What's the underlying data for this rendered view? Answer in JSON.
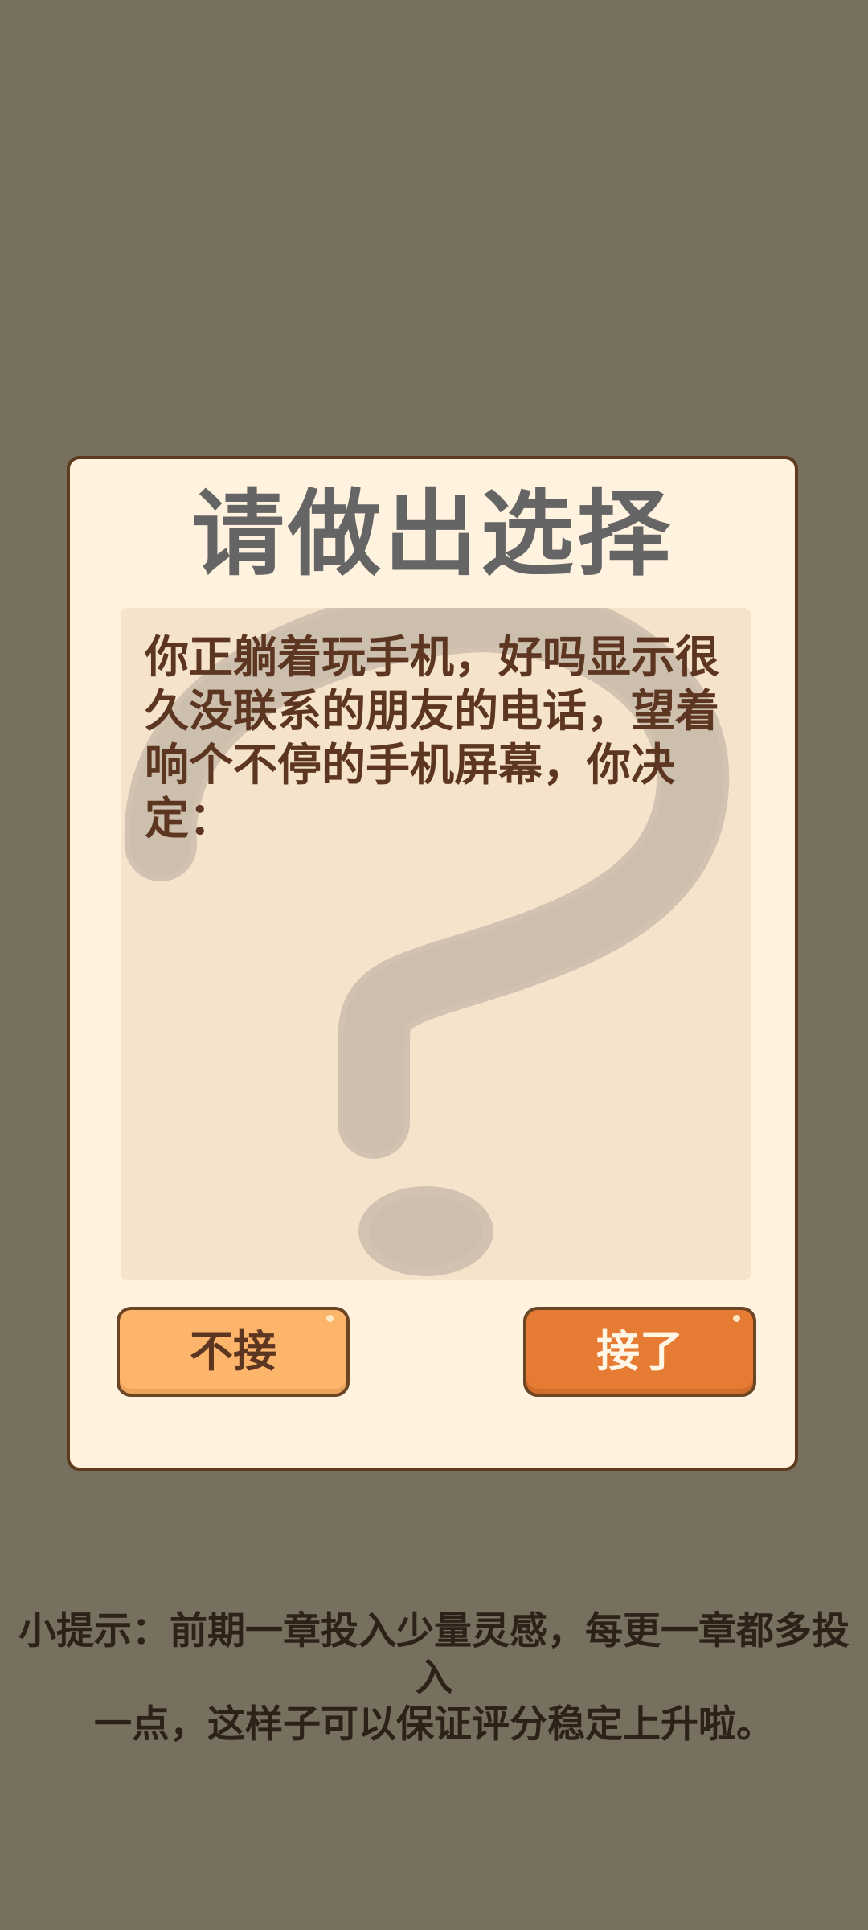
{
  "dialog": {
    "title": "请做出选择",
    "message": "你正躺着玩手机，好吗显示很久没联系的朋友的电话，望着响个不停的手机屏幕，你决定：",
    "art_icon": "question-mark-icon",
    "buttons": {
      "decline": "不接",
      "accept": "接了"
    }
  },
  "tip": {
    "line1": "小提示：前期一章投入少量灵感，每更一章都多投入",
    "line2": "一点，这样子可以保证评分稳定上升啦。"
  },
  "colors": {
    "background": "#77705f",
    "dialog_bg": "#fff3e0",
    "panel_bg": "#f6e3cb",
    "decline_button": "#fdb46b",
    "accept_button": "#e67c34",
    "title_text": "#666565",
    "body_text": "#5c3620"
  }
}
